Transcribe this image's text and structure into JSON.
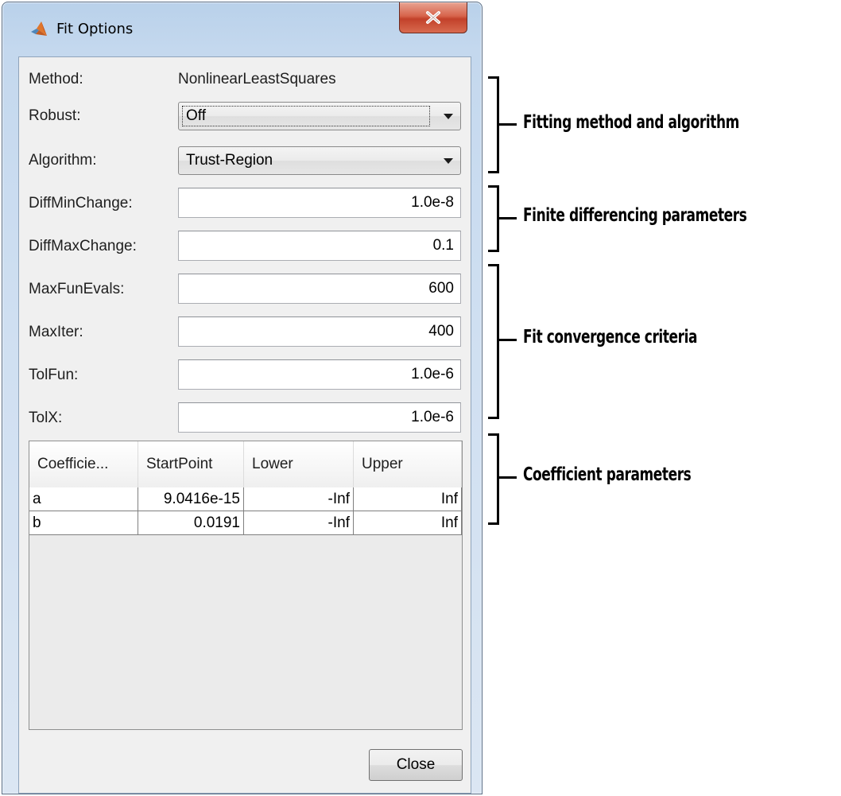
{
  "window": {
    "title": "Fit Options"
  },
  "form": {
    "method": {
      "label": "Method:",
      "value": "NonlinearLeastSquares"
    },
    "robust": {
      "label": "Robust:",
      "value": "Off"
    },
    "algorithm": {
      "label": "Algorithm:",
      "value": "Trust-Region"
    },
    "diff_min_change": {
      "label": "DiffMinChange:",
      "value": "1.0e-8"
    },
    "diff_max_change": {
      "label": "DiffMaxChange:",
      "value": "0.1"
    },
    "max_fun_evals": {
      "label": "MaxFunEvals:",
      "value": "600"
    },
    "max_iter": {
      "label": "MaxIter:",
      "value": "400"
    },
    "tol_fun": {
      "label": "TolFun:",
      "value": "1.0e-6"
    },
    "tol_x": {
      "label": "TolX:",
      "value": "1.0e-6"
    }
  },
  "coefficients": {
    "columns": [
      "Coefficie...",
      "StartPoint",
      "Lower",
      "Upper"
    ],
    "rows": [
      [
        "a",
        "9.0416e-15",
        "-Inf",
        "Inf"
      ],
      [
        "b",
        "0.0191",
        "-Inf",
        "Inf"
      ]
    ]
  },
  "buttons": {
    "close": "Close"
  },
  "annotations": {
    "fitting": "Fitting method and algorithm",
    "finite": "Finite differencing parameters",
    "convergence": "Fit convergence criteria",
    "coefficient": "Coefficient parameters"
  },
  "colors": {
    "window_frame": "#c4d8ee",
    "close_button": "#c94a33",
    "client_background": "#f0f0f0"
  }
}
